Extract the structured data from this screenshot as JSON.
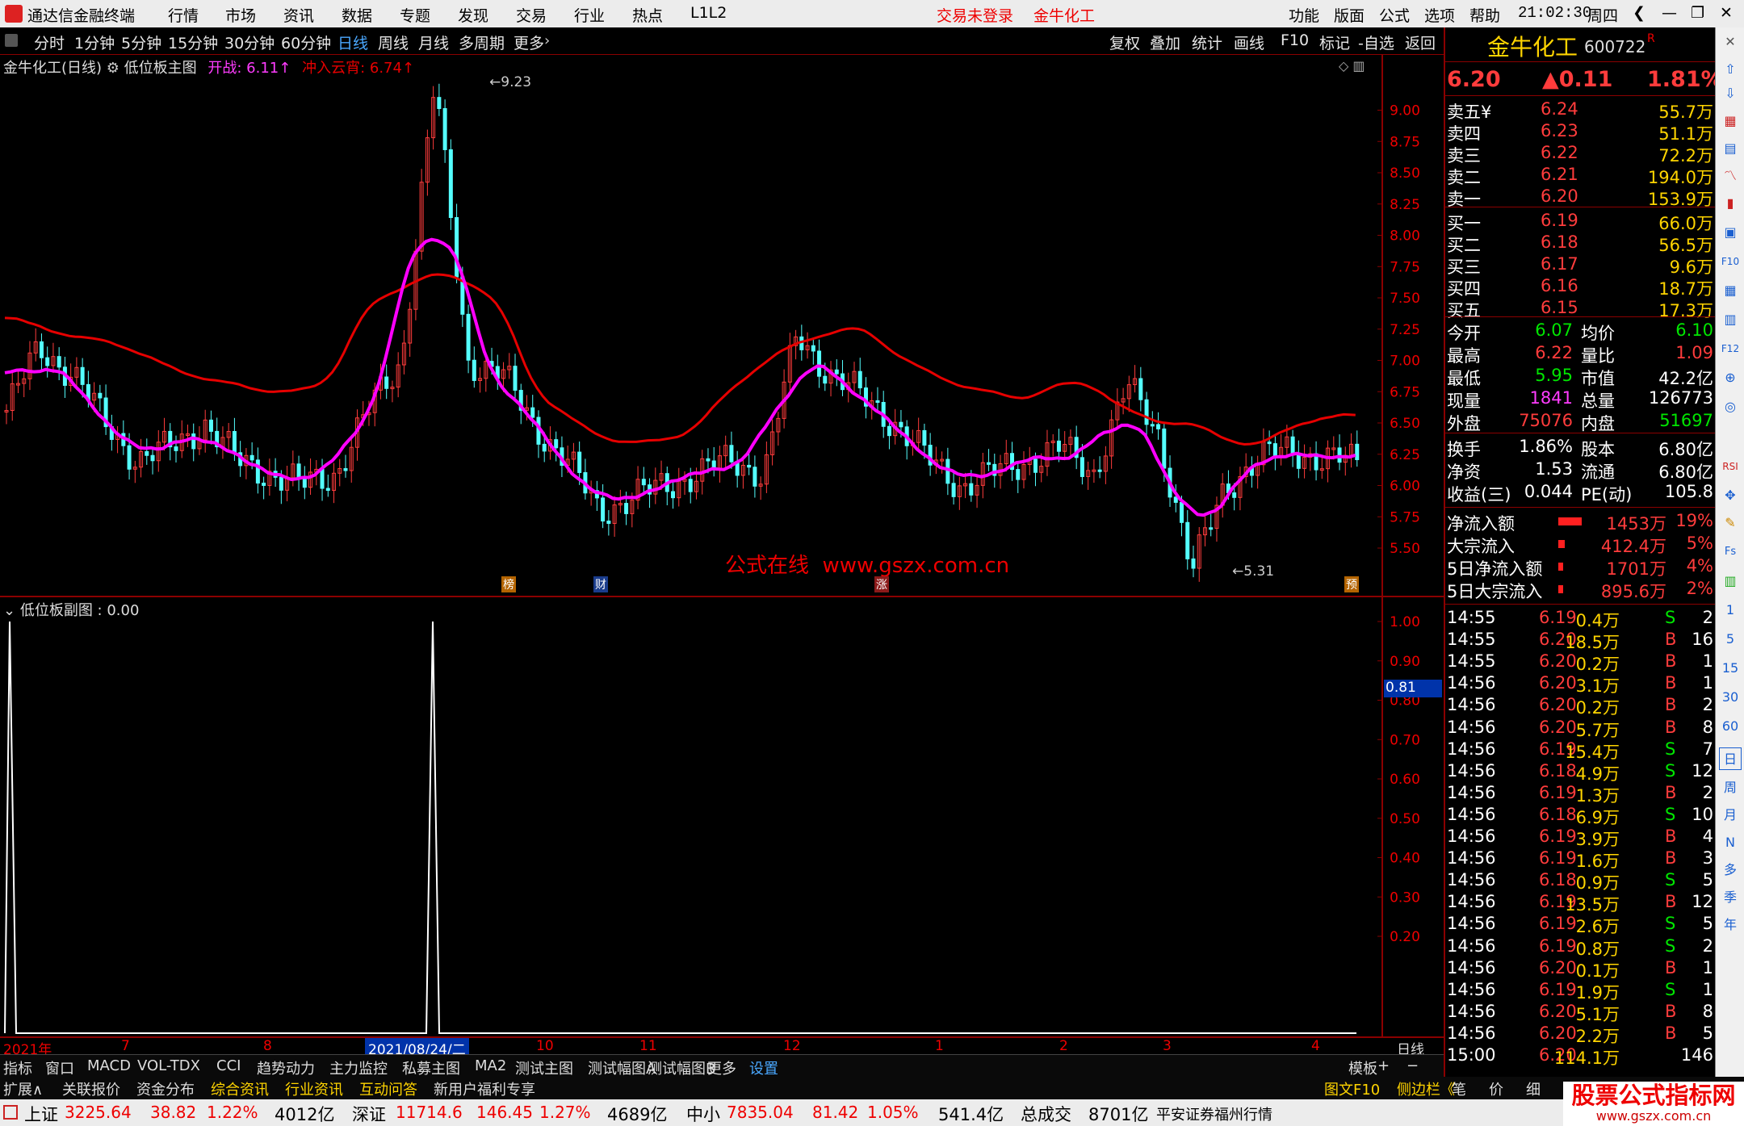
{
  "window": {
    "app_title": "通达信金融终端",
    "menus": [
      "行情",
      "市场",
      "资讯",
      "数据",
      "专题",
      "发现",
      "交易",
      "行业",
      "热点",
      "L1L2"
    ],
    "login_status": "交易未登录",
    "stock_tag": "金牛化工",
    "right_menus": [
      "功能",
      "版面",
      "公式",
      "选项",
      "帮助"
    ],
    "time": "21:02:30",
    "weekday": "周四"
  },
  "period_tabs": [
    "分时",
    "1分钟",
    "5分钟",
    "15分钟",
    "30分钟",
    "60分钟",
    "日线",
    "周线",
    "月线",
    "多周期",
    "更多"
  ],
  "period_active": "日线",
  "right_tools": [
    "复权",
    "叠加",
    "统计",
    "画线",
    "F10",
    "标记",
    "-自选",
    "返回"
  ],
  "main_chart": {
    "header_stock": "金牛化工(日线)",
    "indicator": "低位板主图",
    "open_label": "开战: 6.11",
    "yun_label": "冲入云宵: 6.74",
    "high_mark": "9.23",
    "low_mark": "5.31",
    "watermark": "公式在线  www.gszx.com.cn",
    "event_marks": [
      "榜",
      "财",
      "涨",
      "预"
    ],
    "yticks": [
      "9.00",
      "8.75",
      "8.50",
      "8.25",
      "8.00",
      "7.75",
      "7.50",
      "7.25",
      "7.00",
      "6.75",
      "6.50",
      "6.25",
      "6.00",
      "5.75",
      "5.50"
    ]
  },
  "chart_data": {
    "type": "candlestick",
    "title": "金牛化工(日线)",
    "ylim": [
      5.3,
      9.3
    ],
    "series": [
      {
        "name": "low_band",
        "color": "#ff00ff"
      },
      {
        "name": "high_band",
        "color": "#e60000"
      }
    ],
    "close_samples": [
      6.6,
      7.1,
      6.9,
      6.5,
      6.2,
      6.3,
      6.5,
      6.2,
      6.1,
      6.0,
      6.1,
      6.6,
      7.0,
      9.23,
      7.0,
      6.9,
      6.5,
      6.2,
      5.8,
      5.9,
      6.0,
      6.1,
      6.2,
      6.1,
      7.2,
      6.9,
      6.7,
      6.5,
      6.2,
      6.0,
      6.1,
      6.2,
      6.3,
      6.1,
      6.8,
      6.4,
      5.31,
      6.0,
      6.2,
      6.3,
      6.2,
      6.2
    ],
    "x_axis": [
      "2021年",
      "7",
      "8",
      "2021/08/24/二",
      "10",
      "11",
      "12",
      "1",
      "2",
      "3",
      "4"
    ]
  },
  "sub_chart": {
    "title": "低位板副图 : 0.00",
    "yticks": [
      "1.00",
      "0.90",
      "0.80",
      "0.70",
      "0.60",
      "0.50",
      "0.40",
      "0.30",
      "0.20"
    ],
    "cursor_value": "0.81",
    "signal_values": [
      1,
      1
    ]
  },
  "quote": {
    "name": "金牛化工",
    "code": "600722",
    "suffix": "R",
    "price": "6.20",
    "change": "▲0.11",
    "pct": "1.81%",
    "asks": [
      {
        "label": "卖五",
        "tag": "¥",
        "price": "6.24",
        "vol": "55.7万"
      },
      {
        "label": "卖四",
        "price": "6.23",
        "vol": "51.1万"
      },
      {
        "label": "卖三",
        "price": "6.22",
        "vol": "72.2万"
      },
      {
        "label": "卖二",
        "price": "6.21",
        "vol": "194.0万"
      },
      {
        "label": "卖一",
        "price": "6.20",
        "vol": "153.9万"
      }
    ],
    "bids": [
      {
        "label": "买一",
        "price": "6.19",
        "vol": "66.0万"
      },
      {
        "label": "买二",
        "price": "6.18",
        "vol": "56.5万"
      },
      {
        "label": "买三",
        "price": "6.17",
        "vol": "9.6万"
      },
      {
        "label": "买四",
        "price": "6.16",
        "vol": "18.7万"
      },
      {
        "label": "买五",
        "price": "6.15",
        "vol": "17.3万"
      }
    ],
    "stats": [
      [
        "今开",
        "6.07",
        "均价",
        "6.10"
      ],
      [
        "最高",
        "6.22",
        "量比",
        "1.09"
      ],
      [
        "最低",
        "5.95",
        "市值",
        "42.2亿"
      ],
      [
        "现量",
        "1841",
        "总量",
        "126773"
      ],
      [
        "外盘",
        "75076",
        "内盘",
        "51697"
      ]
    ],
    "stats2": [
      [
        "换手",
        "1.86%",
        "股本",
        "6.80亿"
      ],
      [
        "净资",
        "1.53",
        "流通",
        "6.80亿"
      ],
      [
        "收益(三)",
        "0.044",
        "PE(动)",
        "105.8"
      ]
    ],
    "flows": [
      {
        "label": "净流入额",
        "val": "1453万",
        "pct": "19%",
        "bar": 0.19
      },
      {
        "label": "大宗流入",
        "val": "412.4万",
        "pct": "5%",
        "bar": 0.05
      },
      {
        "label": "5日净流入额",
        "val": "1701万",
        "pct": "4%",
        "bar": 0.04
      },
      {
        "label": "5日大宗流入",
        "val": "895.6万",
        "pct": "2%",
        "bar": 0.02
      }
    ],
    "ticks": [
      [
        "14:55",
        "6.19",
        "0.4万",
        "S",
        "2"
      ],
      [
        "14:55",
        "6.20",
        "18.5万",
        "B",
        "16"
      ],
      [
        "14:55",
        "6.20",
        "0.2万",
        "B",
        "1"
      ],
      [
        "14:56",
        "6.20",
        "3.1万",
        "B",
        "1"
      ],
      [
        "14:56",
        "6.20",
        "0.2万",
        "B",
        "2"
      ],
      [
        "14:56",
        "6.20",
        "5.7万",
        "B",
        "8"
      ],
      [
        "14:56",
        "6.19",
        "15.4万",
        "S",
        "7"
      ],
      [
        "14:56",
        "6.18",
        "4.9万",
        "S",
        "12"
      ],
      [
        "14:56",
        "6.19",
        "1.3万",
        "B",
        "2"
      ],
      [
        "14:56",
        "6.18",
        "6.9万",
        "S",
        "10"
      ],
      [
        "14:56",
        "6.19",
        "3.9万",
        "B",
        "4"
      ],
      [
        "14:56",
        "6.19",
        "1.6万",
        "B",
        "3"
      ],
      [
        "14:56",
        "6.18",
        "0.9万",
        "S",
        "5"
      ],
      [
        "14:56",
        "6.19",
        "13.5万",
        "B",
        "12"
      ],
      [
        "14:56",
        "6.19",
        "2.6万",
        "S",
        "5"
      ],
      [
        "14:56",
        "6.19",
        "0.8万",
        "S",
        "2"
      ],
      [
        "14:56",
        "6.20",
        "0.1万",
        "B",
        "1"
      ],
      [
        "14:56",
        "6.19",
        "1.9万",
        "S",
        "1"
      ],
      [
        "14:56",
        "6.20",
        "5.1万",
        "B",
        "8"
      ],
      [
        "14:56",
        "6.20",
        "2.2万",
        "B",
        "5"
      ],
      [
        "15:00",
        "6.20",
        "114.1万",
        "",
        "146"
      ]
    ]
  },
  "side_tools": [
    "RSI",
    "Fs",
    "1",
    "5",
    "15",
    "30",
    "60",
    "日",
    "周",
    "月",
    "N",
    "多",
    "季",
    "年"
  ],
  "bottom_tabs1": [
    "指标",
    "窗口",
    "MACD",
    "VOL-TDX",
    "CCI",
    "趋势动力",
    "主力监控",
    "私募主图",
    "MA2",
    "测试主图",
    "测试幅图A",
    "测试幅图B",
    "更多",
    "设置"
  ],
  "bottom_tabs1_right": [
    "模板",
    "+",
    "−"
  ],
  "bottom_tabs2": [
    "扩展∧",
    "关联报价",
    "资金分布",
    "综合资讯",
    "行业资讯",
    "互动问答",
    "新用户福利专享"
  ],
  "bottom_tabs2_right": [
    "图文F10",
    "侧边栏《",
    "笔",
    "价",
    "细",
    "势"
  ],
  "period_label": "日线",
  "status": {
    "sh": "上证",
    "sh_val": "3225.64",
    "sh_chg": "38.82",
    "sh_pct": "1.22%",
    "sh_amt": "4012亿",
    "sz": "深证",
    "sz_val": "11714.6",
    "sz_chg": "146.45",
    "sz_pct": "1.27%",
    "sz_amt": "4689亿",
    "zx": "中小",
    "zx_val": "7835.04",
    "zx_chg": "81.42",
    "zx_pct": "1.05%",
    "zx_amt": "541.4亿",
    "total": "总成交",
    "total_amt": "8701亿",
    "broker": "平安证券福州行情",
    "logo": "股票公式指标网",
    "logo_url": "www.gszx.com.cn"
  }
}
